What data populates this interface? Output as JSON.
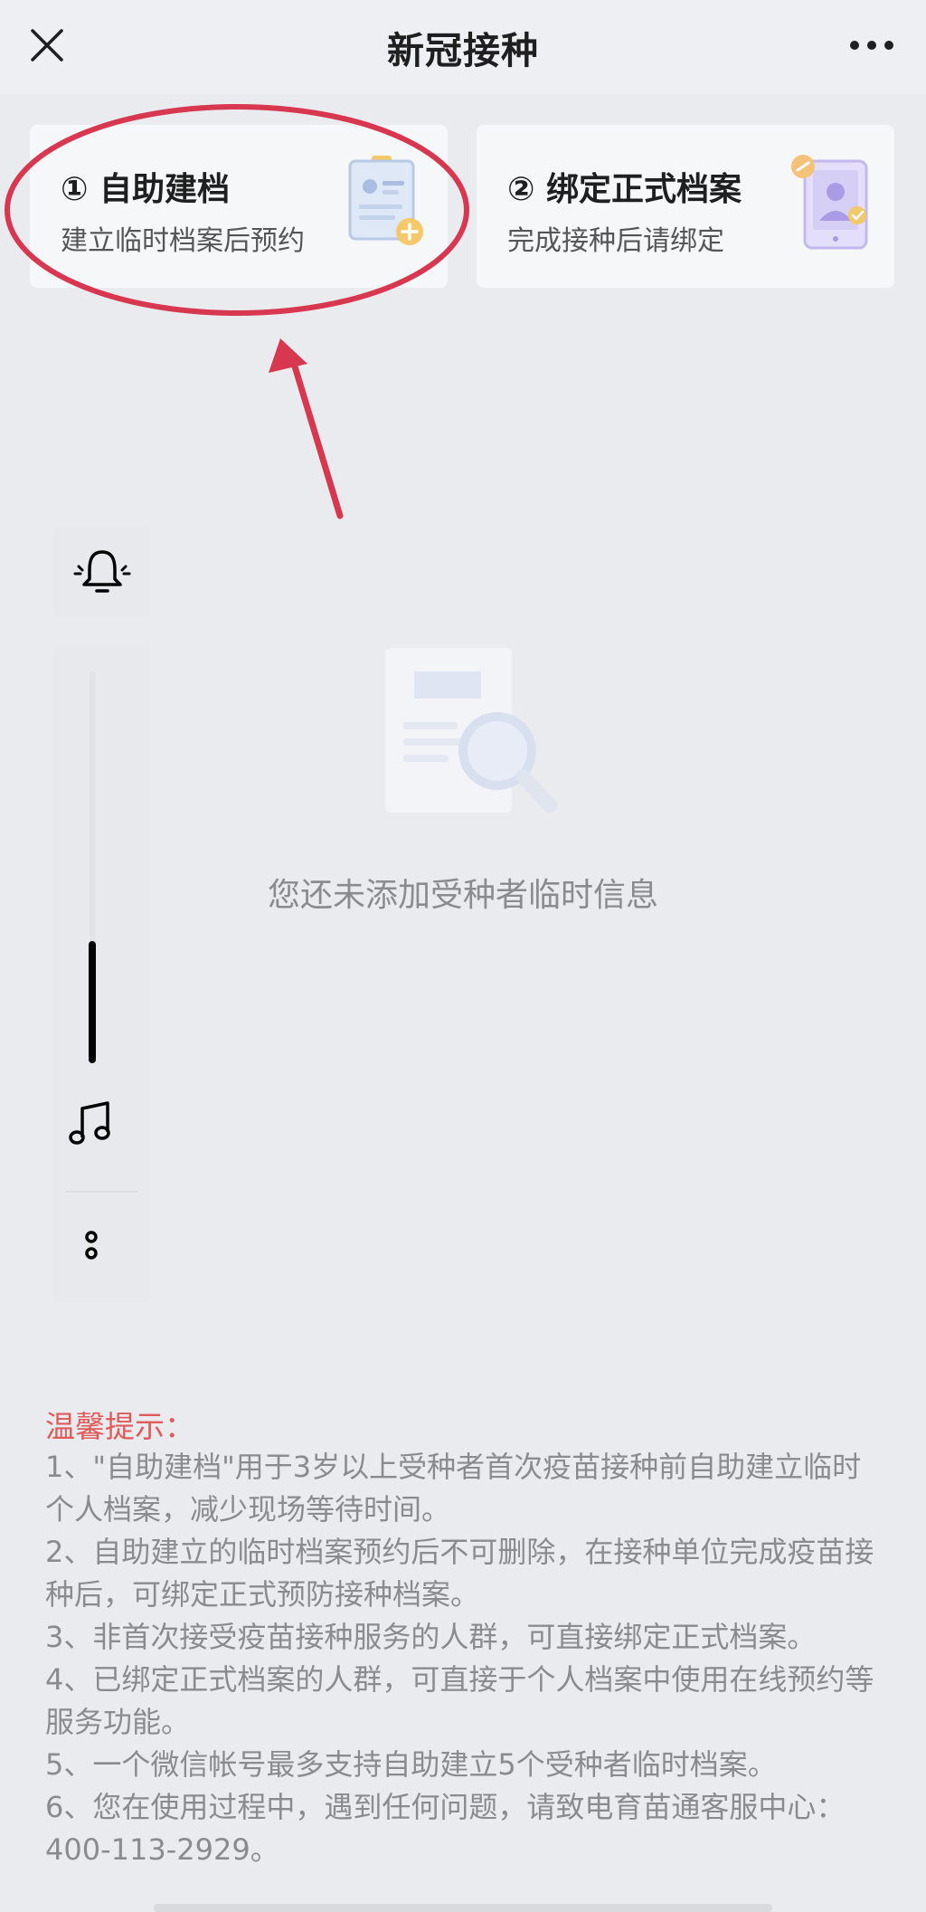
{
  "header": {
    "title": "新冠接种",
    "close_icon": "close-icon",
    "more_icon": "more-dots-icon"
  },
  "cards": [
    {
      "title": "① 自助建档",
      "subtitle": "建立临时档案后预约",
      "icon": "document-add-icon"
    },
    {
      "title": "② 绑定正式档案",
      "subtitle": "完成接种后请绑定",
      "icon": "tablet-user-link-icon"
    }
  ],
  "floating_bar": {
    "bell_icon": "bell-ring-icon",
    "music_icon": "music-note-icon",
    "more_icon": "vertical-dots-icon",
    "volume_level": 0.31
  },
  "empty_state": {
    "icon": "document-search-icon",
    "text": "您还未添加受种者临时信息"
  },
  "tips": {
    "title": "温馨提示：",
    "items": [
      "1、\"自助建档\"用于3岁以上受种者首次疫苗接种前自助建立临时个人档案，减少现场等待时间。",
      "2、自助建立的临时档案预约后不可删除，在接种单位完成疫苗接种后，可绑定正式预防接种档案。",
      "3、非首次接受疫苗接种服务的人群，可直接绑定正式档案。",
      "4、已绑定正式档案的人群，可直接于个人档案中使用在线预约等服务功能。",
      "5、一个微信帐号最多支持自助建立5个受种者临时档案。",
      "6、您在使用过程中，遇到任何问题，请致电育苗通客服中心：400-113-2929。"
    ]
  },
  "colors": {
    "background": "#eaebef",
    "card": "#f6f7f9",
    "tips_title": "#e05a5a",
    "annotation": "#d8384f"
  }
}
